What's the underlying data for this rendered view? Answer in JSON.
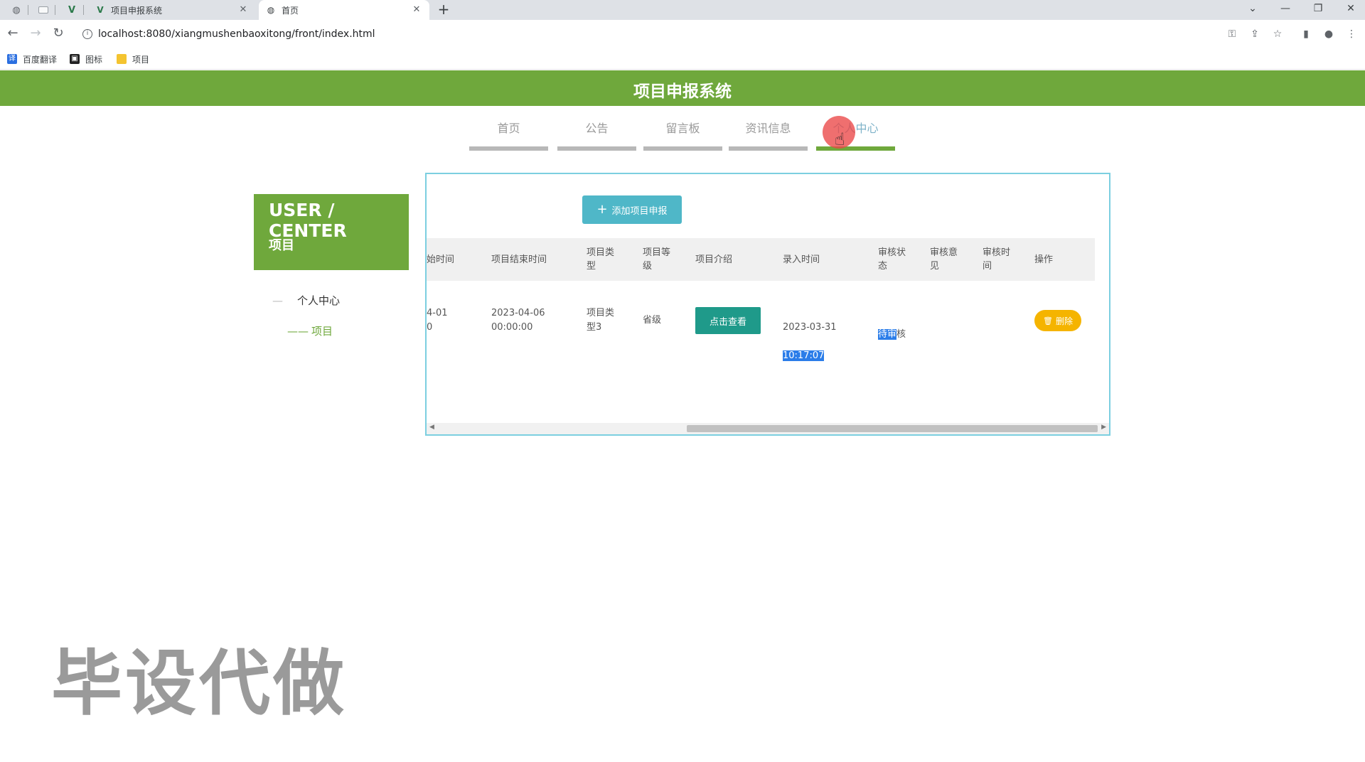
{
  "browser": {
    "tabs": [
      {
        "title": "项目申报系统"
      },
      {
        "title": "首页"
      }
    ],
    "new_tab": "+",
    "url": "localhost:8080/xiangmushenbaoxitong/front/index.html",
    "bookmarks": [
      {
        "label": "百度翻译",
        "icon": "translate-icon"
      },
      {
        "label": "图标",
        "icon": "image-icon"
      },
      {
        "label": "项目",
        "icon": "folder-icon"
      }
    ]
  },
  "site": {
    "title": "项目申报系统",
    "accent": "#6fa83c",
    "nav": [
      {
        "label": "首页",
        "active": false
      },
      {
        "label": "公告",
        "active": false
      },
      {
        "label": "留言板",
        "active": false
      },
      {
        "label": "资讯信息",
        "active": false
      },
      {
        "label": "个人中心",
        "active": true
      }
    ]
  },
  "sidebar": {
    "heading": "USER / CENTER",
    "subheading": "项目",
    "items": [
      {
        "dash": "—",
        "label": "个人中心",
        "active": false
      },
      {
        "dash": "——",
        "label": "项目",
        "active": true
      }
    ]
  },
  "main": {
    "add_button": "添加项目申报",
    "columns": [
      "始时间",
      "项目结束时间",
      "项目类\n型",
      "项目等\n级",
      "项目介绍",
      "录入时间",
      "审核状\n态",
      "审核意\n见",
      "审核时\n间",
      "操作"
    ],
    "rows": [
      {
        "start_time": "4-01\n0",
        "end_time": "2023-04-06\n00:00:00",
        "type": "项目类\n型3",
        "level": "省级",
        "intro_button": "点击查看",
        "entry_date": "2023-03-31",
        "entry_time": "10:17:07",
        "status_highlight": "待审",
        "status_rest": "核",
        "review_opinion": "",
        "review_time": "",
        "delete_button": "删除"
      }
    ]
  },
  "watermark": "毕设代做"
}
